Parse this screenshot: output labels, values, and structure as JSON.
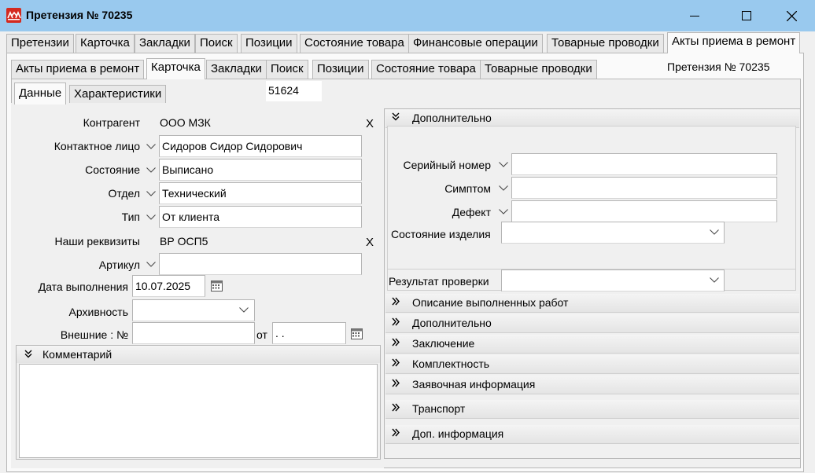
{
  "window": {
    "title": "Претензия № 70235",
    "icon": "app-logo-icon",
    "controls": [
      "minimize-icon",
      "maximize-icon",
      "close-icon"
    ]
  },
  "top_tabs": [
    "Претензии",
    "Карточка",
    "Закладки",
    "Поиск",
    "Позиции",
    "Состояние товара",
    "Финансовые операции",
    "Товарные проводки",
    "Акты приема в ремонт"
  ],
  "top_tabs_active": "Акты приема в ремонт",
  "sub_tabs": [
    "Акты приема в ремонт",
    "Карточка",
    "Закладки",
    "Поиск",
    "Позиции",
    "Состояние товара",
    "Товарные проводки"
  ],
  "sub_tabs_active": "Карточка",
  "header_claim": "Претензия № 70235",
  "inner_tabs": [
    "Данные",
    "Характеристики"
  ],
  "inner_tabs_active": "Данные",
  "record_number": "51624",
  "form": {
    "contractor": {
      "label": "Контрагент",
      "value": "ООО МЗК",
      "clear": "X"
    },
    "contact": {
      "label": "Контактное лицо",
      "value": "Сидоров Сидор Сидорович"
    },
    "state": {
      "label": "Состояние",
      "value": "Выписано"
    },
    "department": {
      "label": "Отдел",
      "value": "Технический"
    },
    "type": {
      "label": "Тип",
      "value": "От клиента"
    },
    "our_details": {
      "label": "Наши реквизиты",
      "value": "ВР ОСП5",
      "clear": "X"
    },
    "article": {
      "label": "Артикул",
      "value": ""
    },
    "done_date": {
      "label": "Дата выполнения",
      "value": "10.07.2025"
    },
    "archive": {
      "label": "Архивность",
      "value": ""
    },
    "external": {
      "label": "Внешние : №",
      "value": "",
      "from_label": "от",
      "from_value": " .  ."
    }
  },
  "comment": {
    "label": "Комментарий",
    "value": ""
  },
  "right": {
    "extra_open": {
      "label": "Дополнительно",
      "serial": {
        "label": "Серийный номер",
        "value": ""
      },
      "symptom": {
        "label": "Симптом",
        "value": ""
      },
      "defect": {
        "label": "Дефект",
        "value": ""
      },
      "product_state": {
        "label": "Состояние изделия",
        "value": ""
      },
      "check_result": {
        "label": "Результат проверки",
        "value": ""
      }
    },
    "sections": [
      "Описание выполненных работ",
      "Дополнительно",
      "Заключение",
      "Комплектность",
      "Заявочная информация",
      "Транспорт",
      "Доп. информация"
    ]
  }
}
